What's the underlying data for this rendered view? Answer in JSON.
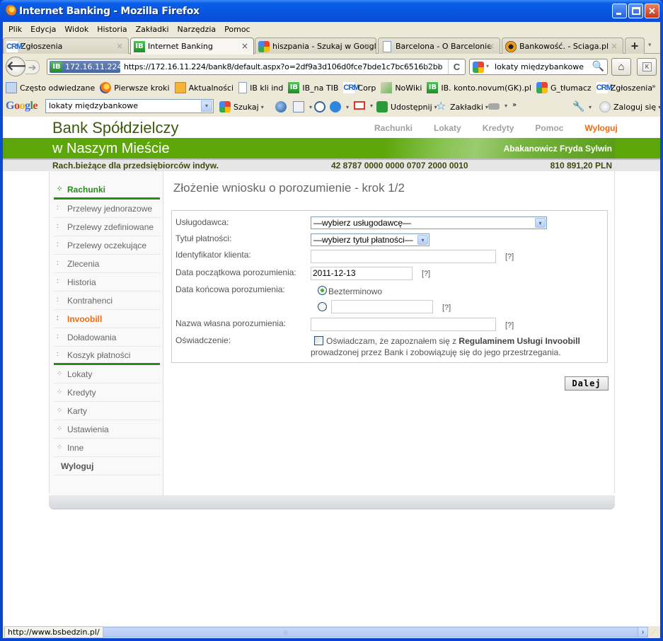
{
  "window": {
    "title": "Internet Banking - Mozilla Firefox",
    "controls": {
      "minimize": "_",
      "maximize": "□",
      "close": "✕"
    }
  },
  "menubar": {
    "items": [
      {
        "label": "Plik",
        "accel": "P"
      },
      {
        "label": "Edycja",
        "accel": "E"
      },
      {
        "label": "Widok",
        "accel": "W"
      },
      {
        "label": "Historia",
        "accel": "H"
      },
      {
        "label": "Zakładki",
        "accel": "Z"
      },
      {
        "label": "Narzędzia",
        "accel": "N"
      },
      {
        "label": "Pomoc",
        "accel": "c"
      }
    ]
  },
  "tabs": [
    {
      "label": "Zgłoszenia",
      "icon": "crm-icon",
      "active": false
    },
    {
      "label": "Internet Banking",
      "icon": "ib-icon",
      "active": true
    },
    {
      "label": "hiszpania - Szukaj w Google",
      "icon": "google-icon",
      "active": false
    },
    {
      "label": "Barcelona - O Barcelonie",
      "icon": "document-icon",
      "active": false
    },
    {
      "label": "Bankowość. - Sciaga.pl",
      "icon": "sciaga-icon",
      "active": false
    }
  ],
  "tab_icons": {
    "crm": "CRM",
    "ib": "IB",
    "close": "×",
    "new_tab": "+",
    "tab_list": "▾"
  },
  "navbar": {
    "back": "🡐",
    "forward": "➔",
    "identity": "172.16.11.224",
    "url": "https://172.16.11.224/bank8/default.aspx?o=2df9a3d106d0fce7bde1c7bc6516b2bb",
    "bookmark_star": "☆",
    "dropdown": "▾",
    "reload": "C",
    "search_value": "lokaty międzybankowe",
    "search_go": "🔍",
    "home": "⌂",
    "k_button": "K"
  },
  "bookmarks": {
    "items": [
      {
        "label": "Często odwiedzane",
        "icon": "often-visited-icon"
      },
      {
        "label": "Pierwsze kroki",
        "icon": "firefox-icon"
      },
      {
        "label": "Aktualności",
        "icon": "rss-icon"
      },
      {
        "label": "IB kli ind",
        "icon": "document-icon"
      },
      {
        "label": "IB_na TIB",
        "icon": "ib-icon"
      },
      {
        "label": "Corp",
        "icon": "crm-icon"
      },
      {
        "label": "NoWiki",
        "icon": "nowiki-icon"
      },
      {
        "label": "IB. konto.novum(GK).pl",
        "icon": "ib-icon"
      },
      {
        "label": "G_tłumacz",
        "icon": "google-icon"
      },
      {
        "label": "Zgłoszenia",
        "icon": "crm-icon"
      }
    ],
    "more": "»"
  },
  "google_toolbar": {
    "logo": "Google",
    "input_value": "lokaty międzybankowe",
    "search_label": "Szukaj",
    "share_label": "Udostępnij",
    "bookmarks_label": "Zakładki",
    "more": "»",
    "login_label": "Zaloguj się",
    "caret": "▾"
  },
  "bank": {
    "name_line1": "Bank Spółdzielczy",
    "name_line2": "w Naszym Mieście",
    "topnav": [
      "Rachunki",
      "Lokaty",
      "Kredyty",
      "Pomoc"
    ],
    "topnav_logout": "Wyloguj",
    "user": "Abakanowicz Fryda Sylwin",
    "account_type": "Rach.bieżące dla przedsiębiorców indyw.",
    "account_number": "42 8787 0000 0000 0707 2000 0010",
    "balance": "810 891,20 PLN",
    "accent_green": "#5ca60a",
    "accent_orange": "#f26a10"
  },
  "sidebar": {
    "head": "Rachunki",
    "items": [
      "Przelewy jednorazowe",
      "Przelewy zdefiniowane",
      "Przelewy oczekujące",
      "Zlecenia",
      "Historia",
      "Kontrahenci",
      "Invoobill",
      "Doładowania",
      "Koszyk płatności"
    ],
    "current": "Invoobill",
    "sections": [
      "Lokaty",
      "Kredyty",
      "Karty",
      "Ustawienia",
      "Inne"
    ],
    "logout": "Wyloguj",
    "bullet_sub": "∶",
    "bullet_section": "⁘"
  },
  "form": {
    "title": "Złożenie wniosku o porozumienie - krok 1/2",
    "labels": {
      "provider": "Usługodawca:",
      "payment_title": "Tytuł płatności:",
      "client_id": "Identyfikator klienta:",
      "start_date": "Data początkowa porozumienia:",
      "end_date": "Data końcowa porozumienia:",
      "own_name": "Nazwa własna porozumienia:",
      "declaration": "Oświadczenie:"
    },
    "provider_select": "—wybierz usługodawcę—",
    "payment_title_select": "—wybierz tytuł płatności—",
    "client_id_value": "",
    "start_date_value": "2011-12-13",
    "end_date_option_indefinite": "Bezterminowo",
    "end_date_selected": "indefinite",
    "end_date_value": "",
    "own_name_value": "",
    "help": "[?]",
    "declaration_checked": false,
    "declaration_text_1": "Oświadczam, że zapoznałem się z",
    "declaration_link": "Regulaminem Usługi Invoobill",
    "declaration_text_2": "prowadzonej przez Bank i zobowiązuję się do jego przestrzegania.",
    "next_button": "Dalej",
    "select_arrow": "▾"
  },
  "statusbar": {
    "text": "http://www.bsbedzin.pl/",
    "scroll_right": "›",
    "grip": "⦙⦙⦙"
  }
}
